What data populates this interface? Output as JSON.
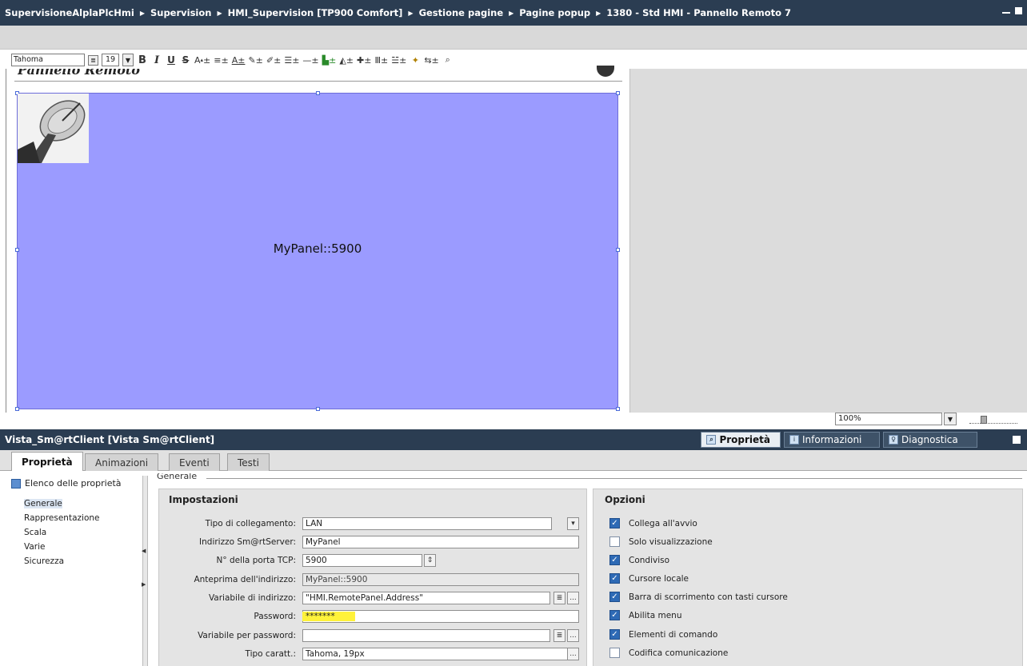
{
  "titlebar": {
    "crumbs": [
      "SupervisioneAlplaPlcHmi",
      "Supervision",
      "HMI_Supervision [TP900 Comfort]",
      "Gestione pagine",
      "Pagine popup",
      "1380 - Std HMI - Pannello Remoto 7"
    ]
  },
  "toolbar": {
    "font": "Tahoma",
    "size": "19",
    "bold": "B",
    "italic": "I",
    "underline": "U",
    "strike": "S"
  },
  "canvas": {
    "popup_title": "Pannello Remoto",
    "panel_text": "MyPanel::5900"
  },
  "zoom": {
    "value": "100%"
  },
  "inspector": {
    "title": "Vista_Sm@rtClient [Vista Sm@rtClient]",
    "tabs": [
      "Proprietà",
      "Informazioni",
      "Diagnostica"
    ],
    "subtabs": [
      "Proprietà",
      "Animazioni",
      "Eventi",
      "Testi"
    ],
    "nav_header": "Elenco delle proprietà",
    "nav_items": [
      "Generale",
      "Rappresentazione",
      "Scala",
      "Varie",
      "Sicurezza"
    ],
    "group_label": "Generale",
    "settings": {
      "heading": "Impostazioni",
      "rows": [
        {
          "label": "Tipo di collegamento:",
          "value": "LAN"
        },
        {
          "label": "Indirizzo Sm@rtServer:",
          "value": "MyPanel"
        },
        {
          "label": "N° della porta TCP:",
          "value": "5900"
        },
        {
          "label": "Anteprima dell'indirizzo:",
          "value": "MyPanel::5900"
        },
        {
          "label": "Variabile di indirizzo:",
          "value": "\"HMI.RemotePanel.Address\""
        },
        {
          "label": "Password:",
          "value": "*******"
        },
        {
          "label": "Variabile per password:",
          "value": ""
        },
        {
          "label": "Tipo caratt.:",
          "value": "Tahoma, 19px"
        }
      ]
    },
    "options": {
      "heading": "Opzioni",
      "items": [
        {
          "label": "Collega all'avvio",
          "checked": true
        },
        {
          "label": "Solo visualizzazione",
          "checked": false
        },
        {
          "label": "Condiviso",
          "checked": true
        },
        {
          "label": "Cursore locale",
          "checked": true
        },
        {
          "label": "Barra di scorrimento con tasti cursore",
          "checked": true
        },
        {
          "label": "Abilita menu",
          "checked": true
        },
        {
          "label": "Elementi di comando",
          "checked": true
        },
        {
          "label": "Codifica comunicazione",
          "checked": false
        }
      ]
    }
  },
  "icons": {
    "browse": "...",
    "list": "≣",
    "check": "✓",
    "dropdown": "▾",
    "spinner": "⇕"
  }
}
